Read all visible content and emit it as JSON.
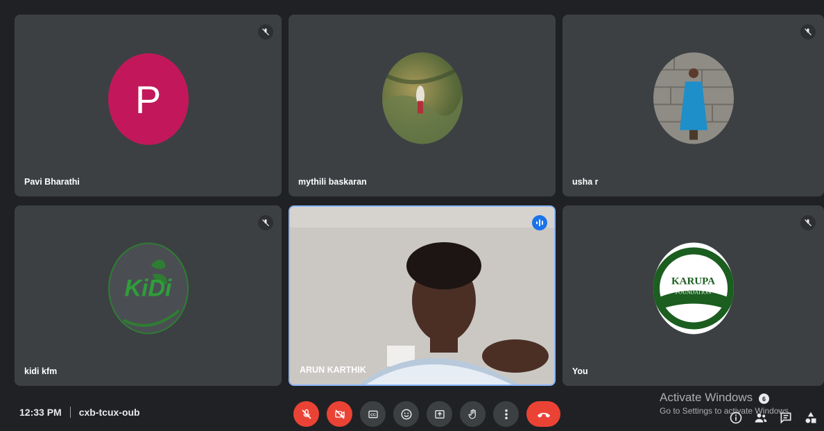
{
  "participants": [
    {
      "name": "Pavi Bharathi",
      "initial": "P",
      "avatar_color": "#c2185b",
      "muted": true
    },
    {
      "name": "mythili baskaran",
      "avatar": "profile-photo-nature",
      "muted": false
    },
    {
      "name": "usha r",
      "avatar": "profile-photo-woman-blue-dress",
      "muted": true
    },
    {
      "name": "kidi kfm",
      "avatar": "kidi-logo",
      "avatar_text": "KiDi",
      "muted": true
    },
    {
      "name": "ARUN KARTHIK",
      "avatar": "live-video",
      "muted": false,
      "speaking": true
    },
    {
      "name": "You",
      "avatar": "karupa-foundation-logo",
      "logo_text_main": "KARUPA",
      "logo_text_sub": "FOUNDATION",
      "muted": true
    }
  ],
  "meeting": {
    "time": "12:33 PM",
    "code": "cxb-tcux-oub"
  },
  "controls": [
    {
      "name": "mic-off-icon",
      "active": true
    },
    {
      "name": "camera-off-icon",
      "active": true
    },
    {
      "name": "captions-icon",
      "active": false
    },
    {
      "name": "emoji-icon",
      "active": false
    },
    {
      "name": "present-icon",
      "active": false
    },
    {
      "name": "raise-hand-icon",
      "active": false
    },
    {
      "name": "more-options-icon",
      "active": false
    },
    {
      "name": "end-call-icon",
      "active": true
    }
  ],
  "right_tools": {
    "people_count": "6"
  },
  "watermark": {
    "line1": "Activate Windows",
    "line2": "Go to Settings to activate Windows."
  },
  "colors": {
    "accent": "#1a73e8",
    "danger": "#ea4335",
    "tile": "#3c4043"
  }
}
